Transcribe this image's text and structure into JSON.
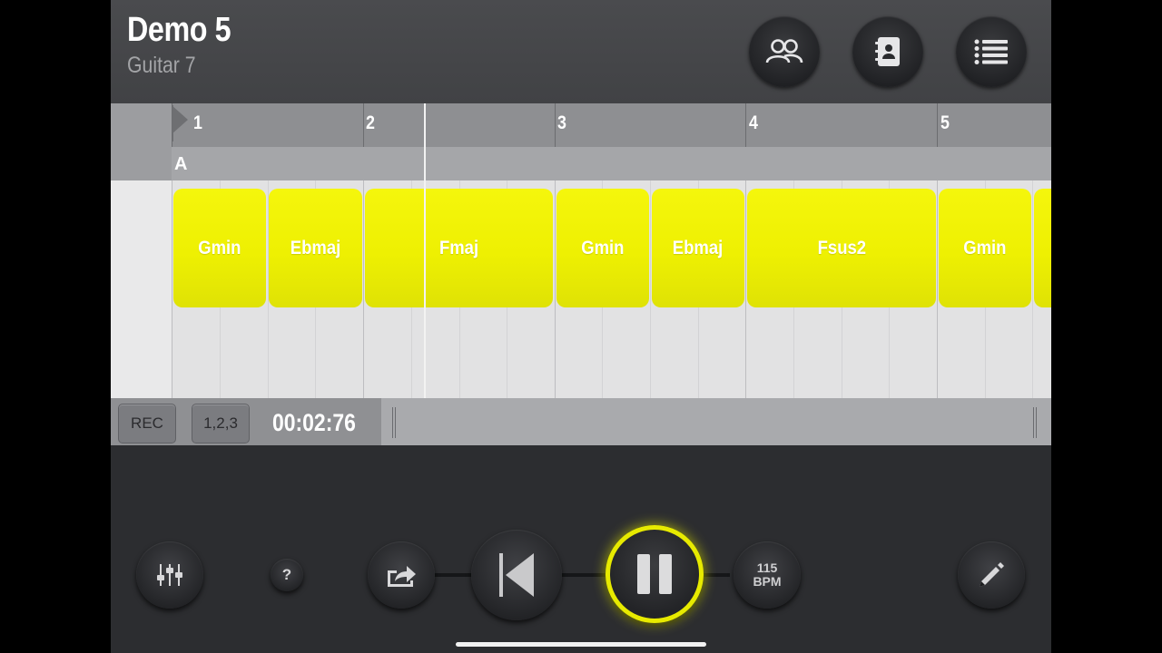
{
  "header": {
    "song_title": "Demo 5",
    "track_name": "Guitar 7",
    "buttons": [
      {
        "name": "collaborators-icon"
      },
      {
        "name": "contacts-book-icon"
      },
      {
        "name": "list-menu-icon"
      }
    ]
  },
  "ruler": {
    "bars": [
      "1",
      "2",
      "3",
      "4",
      "5"
    ],
    "section": "A"
  },
  "chords": [
    "Gmin",
    "Ebmaj",
    "Fmaj",
    "Gmin",
    "Ebmaj",
    "Fsus2",
    "Gmin"
  ],
  "chord_color": "#eef002",
  "transport": {
    "rec_label": "REC",
    "countin_label": "1,2,3",
    "time": "00:02:76"
  },
  "controls": {
    "help_label": "?",
    "tempo_value": "115",
    "tempo_unit": "BPM",
    "play_state_icon": "pause-icon",
    "accent_color": "#e7ea00"
  }
}
